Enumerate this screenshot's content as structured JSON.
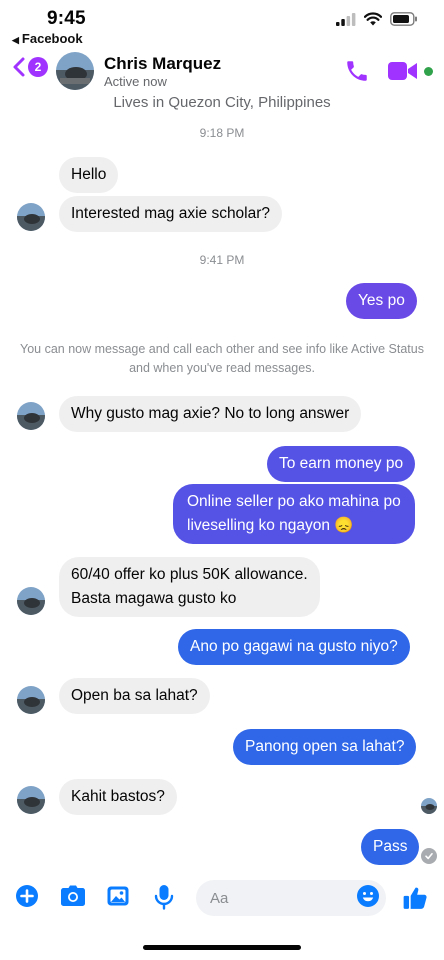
{
  "status_bar": {
    "time": "9:45",
    "back_app": "Facebook"
  },
  "header": {
    "back_badge_count": "2",
    "contact_name": "Chris Marquez",
    "contact_status": "Active now",
    "location": "Lives in Quezon City, Philippines",
    "icons": [
      "chevron-left-icon",
      "phone-icon",
      "video-camera-icon"
    ],
    "accent_color": "#a033ff"
  },
  "conversation": {
    "time_separators": [
      "9:18 PM",
      "9:41 PM"
    ],
    "notice": "You can now message and call each other and see info like Active Status and when you've read messages.",
    "messages": [
      {
        "from": "them",
        "text": "Hello"
      },
      {
        "from": "them",
        "text": "Interested mag axie scholar?"
      },
      {
        "from": "me",
        "text": "Yes po"
      },
      {
        "from": "them",
        "text": "Why gusto mag axie? No to long answer"
      },
      {
        "from": "me",
        "text": "To earn money po"
      },
      {
        "from": "me",
        "lines": [
          "Online seller po ako mahina po",
          "liveselling ko ngayon 😞"
        ]
      },
      {
        "from": "them",
        "lines": [
          "60/40 offer ko plus 50K allowance.",
          "Basta magawa gusto ko"
        ]
      },
      {
        "from": "me",
        "text": "Ano po gagawi  na gusto niyo?"
      },
      {
        "from": "them",
        "text": "Open ba sa lahat?"
      },
      {
        "from": "me",
        "text": "Panong open sa lahat?"
      },
      {
        "from": "them",
        "text": "Kahit bastos?"
      },
      {
        "from": "me",
        "text": "Pass"
      }
    ]
  },
  "composer": {
    "placeholder": "Aa",
    "icons": [
      "plus-icon",
      "camera-icon",
      "gallery-icon",
      "microphone-icon",
      "emoji-icon",
      "thumbs-up-icon"
    ],
    "accent_color": "#0a7cff"
  }
}
